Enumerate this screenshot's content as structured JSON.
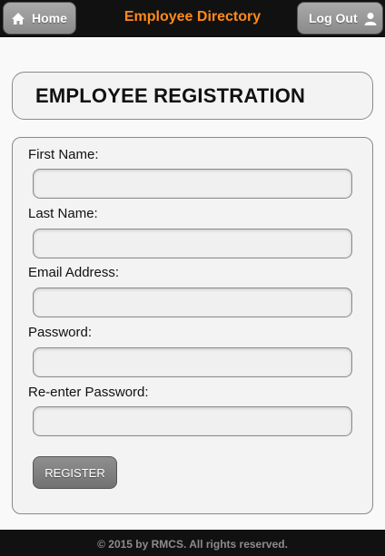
{
  "header": {
    "title": "Employee Directory",
    "home_label": "Home",
    "logout_label": "Log Out",
    "title_color": "#ff8a1a"
  },
  "page": {
    "heading": "EMPLOYEE REGISTRATION"
  },
  "form": {
    "fields": [
      {
        "label": "First Name:",
        "value": ""
      },
      {
        "label": "Last Name:",
        "value": ""
      },
      {
        "label": "Email Address:",
        "value": ""
      },
      {
        "label": "Password:",
        "value": ""
      },
      {
        "label": "Re-enter Password:",
        "value": ""
      }
    ],
    "register_label": "REGISTER"
  },
  "footer": {
    "text": "© 2015 by RMCS. All rights reserved."
  },
  "icons": {
    "home": "home-icon",
    "logout": "user-icon"
  }
}
